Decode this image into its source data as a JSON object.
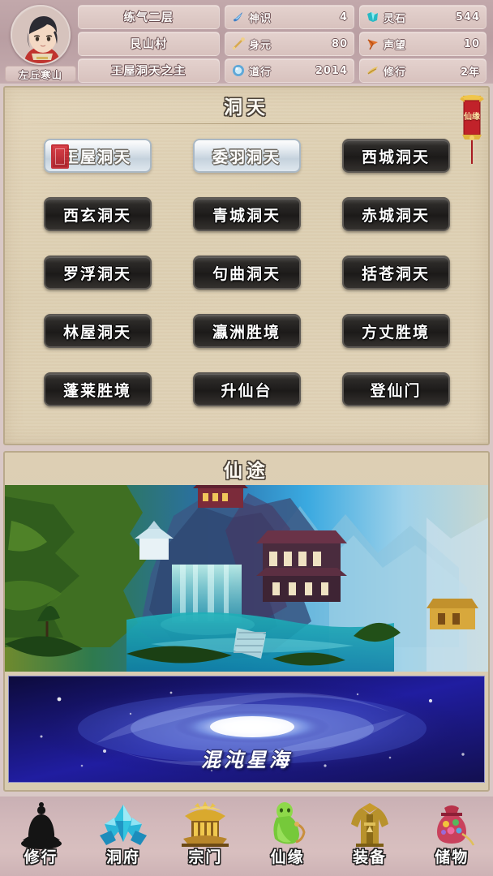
{
  "header": {
    "player_name": "左丘寒山",
    "avatar_icon": "player-portrait-icon",
    "titles": {
      "realm": "练气二层",
      "location": "艮山村",
      "rank": "王屋洞天之主"
    },
    "stats_left": [
      {
        "icon": "spirit-wisp-icon",
        "label": "神识",
        "value": "4"
      },
      {
        "icon": "bone-staff-icon",
        "label": "身元",
        "value": "80"
      },
      {
        "icon": "blue-orb-icon",
        "label": "道行",
        "value": "2014"
      }
    ],
    "stats_right": [
      {
        "icon": "spirit-stone-icon",
        "label": "灵石",
        "value": "544"
      },
      {
        "icon": "banner-flag-icon",
        "label": "声望",
        "value": "10"
      },
      {
        "icon": "scroll-icon",
        "label": "修行",
        "value": "2年"
      }
    ]
  },
  "grotto_panel": {
    "title": "洞天",
    "side_banner": {
      "icon": "hanging-banner-icon",
      "label": "仙缘"
    },
    "items": [
      {
        "label": "王屋洞天",
        "state": "light",
        "seal": true
      },
      {
        "label": "委羽洞天",
        "state": "light",
        "seal": false
      },
      {
        "label": "西城洞天",
        "state": "dark",
        "seal": false
      },
      {
        "label": "西玄洞天",
        "state": "dark",
        "seal": false
      },
      {
        "label": "青城洞天",
        "state": "dark",
        "seal": false
      },
      {
        "label": "赤城洞天",
        "state": "dark",
        "seal": false
      },
      {
        "label": "罗浮洞天",
        "state": "dark",
        "seal": false
      },
      {
        "label": "句曲洞天",
        "state": "dark",
        "seal": false
      },
      {
        "label": "括苍洞天",
        "state": "dark",
        "seal": false
      },
      {
        "label": "林屋洞天",
        "state": "dark",
        "seal": false
      },
      {
        "label": "瀛洲胜境",
        "state": "dark",
        "seal": false
      },
      {
        "label": "方丈胜境",
        "state": "dark",
        "seal": false
      },
      {
        "label": "蓬莱胜境",
        "state": "dark",
        "seal": false
      },
      {
        "label": "升仙台",
        "state": "dark",
        "seal": false
      },
      {
        "label": "登仙门",
        "state": "dark",
        "seal": false
      }
    ]
  },
  "path_panel": {
    "title": "仙途",
    "scene": {
      "name": "immortal-landscape-image"
    },
    "galaxy": {
      "label": "混沌星海",
      "name": "chaos-star-sea-image"
    }
  },
  "nav": [
    {
      "label": "修行",
      "icon": "meditating-buddha-icon"
    },
    {
      "label": "洞府",
      "icon": "blue-crystal-icon"
    },
    {
      "label": "宗门",
      "icon": "gold-temple-icon"
    },
    {
      "label": "仙缘",
      "icon": "green-immortal-icon"
    },
    {
      "label": "装备",
      "icon": "gold-robe-icon"
    },
    {
      "label": "储物",
      "icon": "treasure-pouch-icon"
    }
  ],
  "colors": {
    "header_bg": "#bc9fa3",
    "panel_bg": "#ddcfb2",
    "panel_border": "#b9a98b",
    "button_dark": "#1c1a19",
    "button_light": "#dfe7ee",
    "seal_red": "#c0222a",
    "nav_bg": "#d3b9bb"
  }
}
